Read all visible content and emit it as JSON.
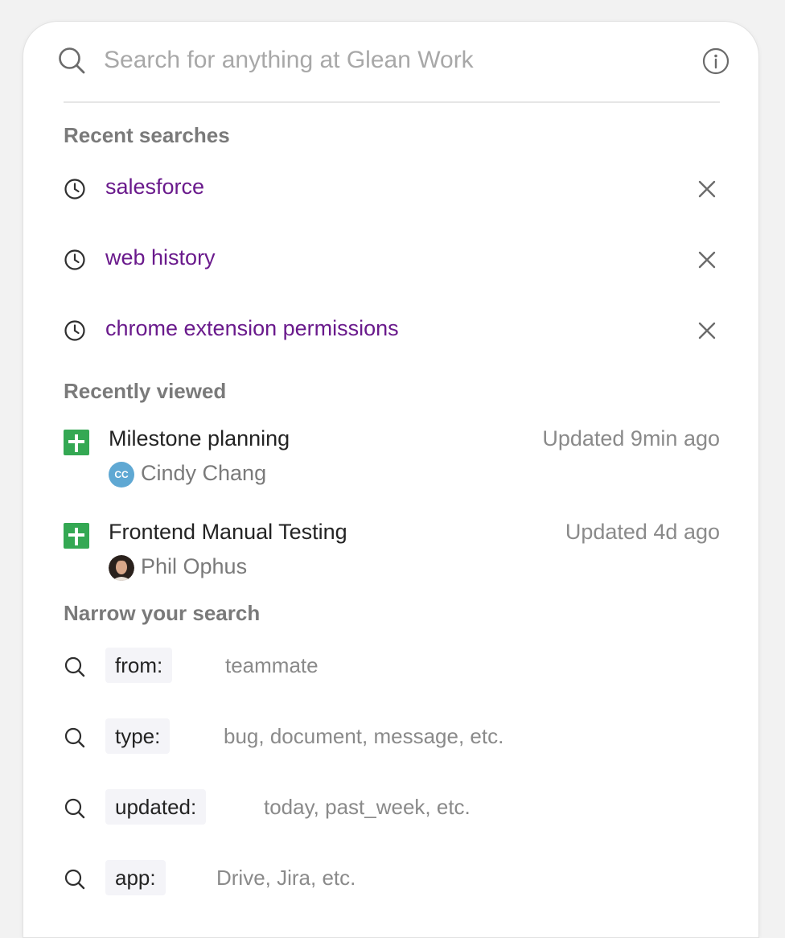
{
  "search": {
    "placeholder": "Search for anything at Glean Work"
  },
  "recent_searches": {
    "title": "Recent searches",
    "items": [
      {
        "query": "salesforce"
      },
      {
        "query": "web history"
      },
      {
        "query": "chrome extension permissions"
      }
    ]
  },
  "recently_viewed": {
    "title": "Recently viewed",
    "items": [
      {
        "title": "Milestone planning",
        "updated": "Updated 9min ago",
        "owner": "Cindy Chang",
        "initials": "CC",
        "icon": "google-sheets-icon"
      },
      {
        "title": "Frontend Manual Testing",
        "updated": "Updated 4d ago",
        "owner": "Phil Ophus",
        "initials": "",
        "icon": "google-sheets-icon"
      }
    ]
  },
  "narrow": {
    "title": "Narrow your search",
    "items": [
      {
        "operator": "from:",
        "hint": "teammate"
      },
      {
        "operator": "type:",
        "hint": "bug, document, message, etc."
      },
      {
        "operator": "updated:",
        "hint": "today, past_week, etc."
      },
      {
        "operator": "app:",
        "hint": "Drive, Jira, etc."
      }
    ]
  },
  "colors": {
    "query_link": "#6a1a8c",
    "sheets_green": "#34a853",
    "avatar_blue": "#5fa8d3"
  }
}
